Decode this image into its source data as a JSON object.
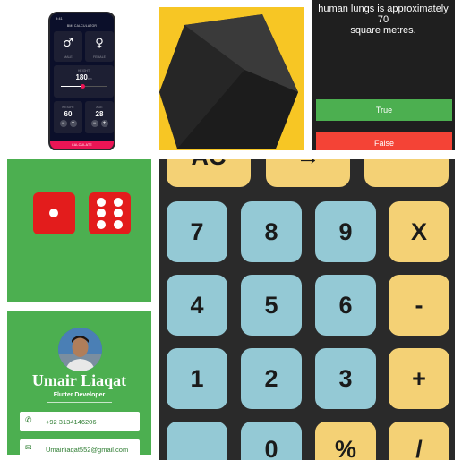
{
  "bmi_app": {
    "status_time": "9:41",
    "title": "BMI CALCULATOR",
    "male_icon": "male-symbol-icon",
    "female_icon": "female-symbol-icon",
    "male_label": "MALE",
    "female_label": "FEMALE",
    "height_label": "HEIGHT",
    "height_value": "180",
    "height_unit": "cm",
    "height_slider_fraction": 0.48,
    "weight_label": "WEIGHT",
    "weight_value": "60",
    "age_label": "AGE",
    "age_value": "28",
    "minus": "−",
    "plus": "+",
    "calculate_label": "CALCULATE",
    "accent": "#eb1555"
  },
  "quiz_app": {
    "question_line1": "human lungs is approximately 70",
    "question_line2": "square metres.",
    "true_label": "True",
    "false_label": "False",
    "true_color": "#4caf50",
    "false_color": "#f44336"
  },
  "dice_app": {
    "left_die": 1,
    "right_die": 6,
    "die_color": "#e31c1c"
  },
  "card_app": {
    "name": "Umair Liaqat",
    "role": "Flutter Developer",
    "phone": "+92 3134146206",
    "email": "Umairliaqat552@gmail.com",
    "phone_icon": "phone-icon",
    "email_icon": "email-icon"
  },
  "calculator_app": {
    "row0": [
      "AC",
      "→",
      "−"
    ],
    "row1": [
      "7",
      "8",
      "9",
      "X"
    ],
    "row2": [
      "4",
      "5",
      "6",
      "-"
    ],
    "row3": [
      "1",
      "2",
      "3",
      "+"
    ],
    "row4": [
      "",
      "0",
      "%",
      "/"
    ]
  }
}
